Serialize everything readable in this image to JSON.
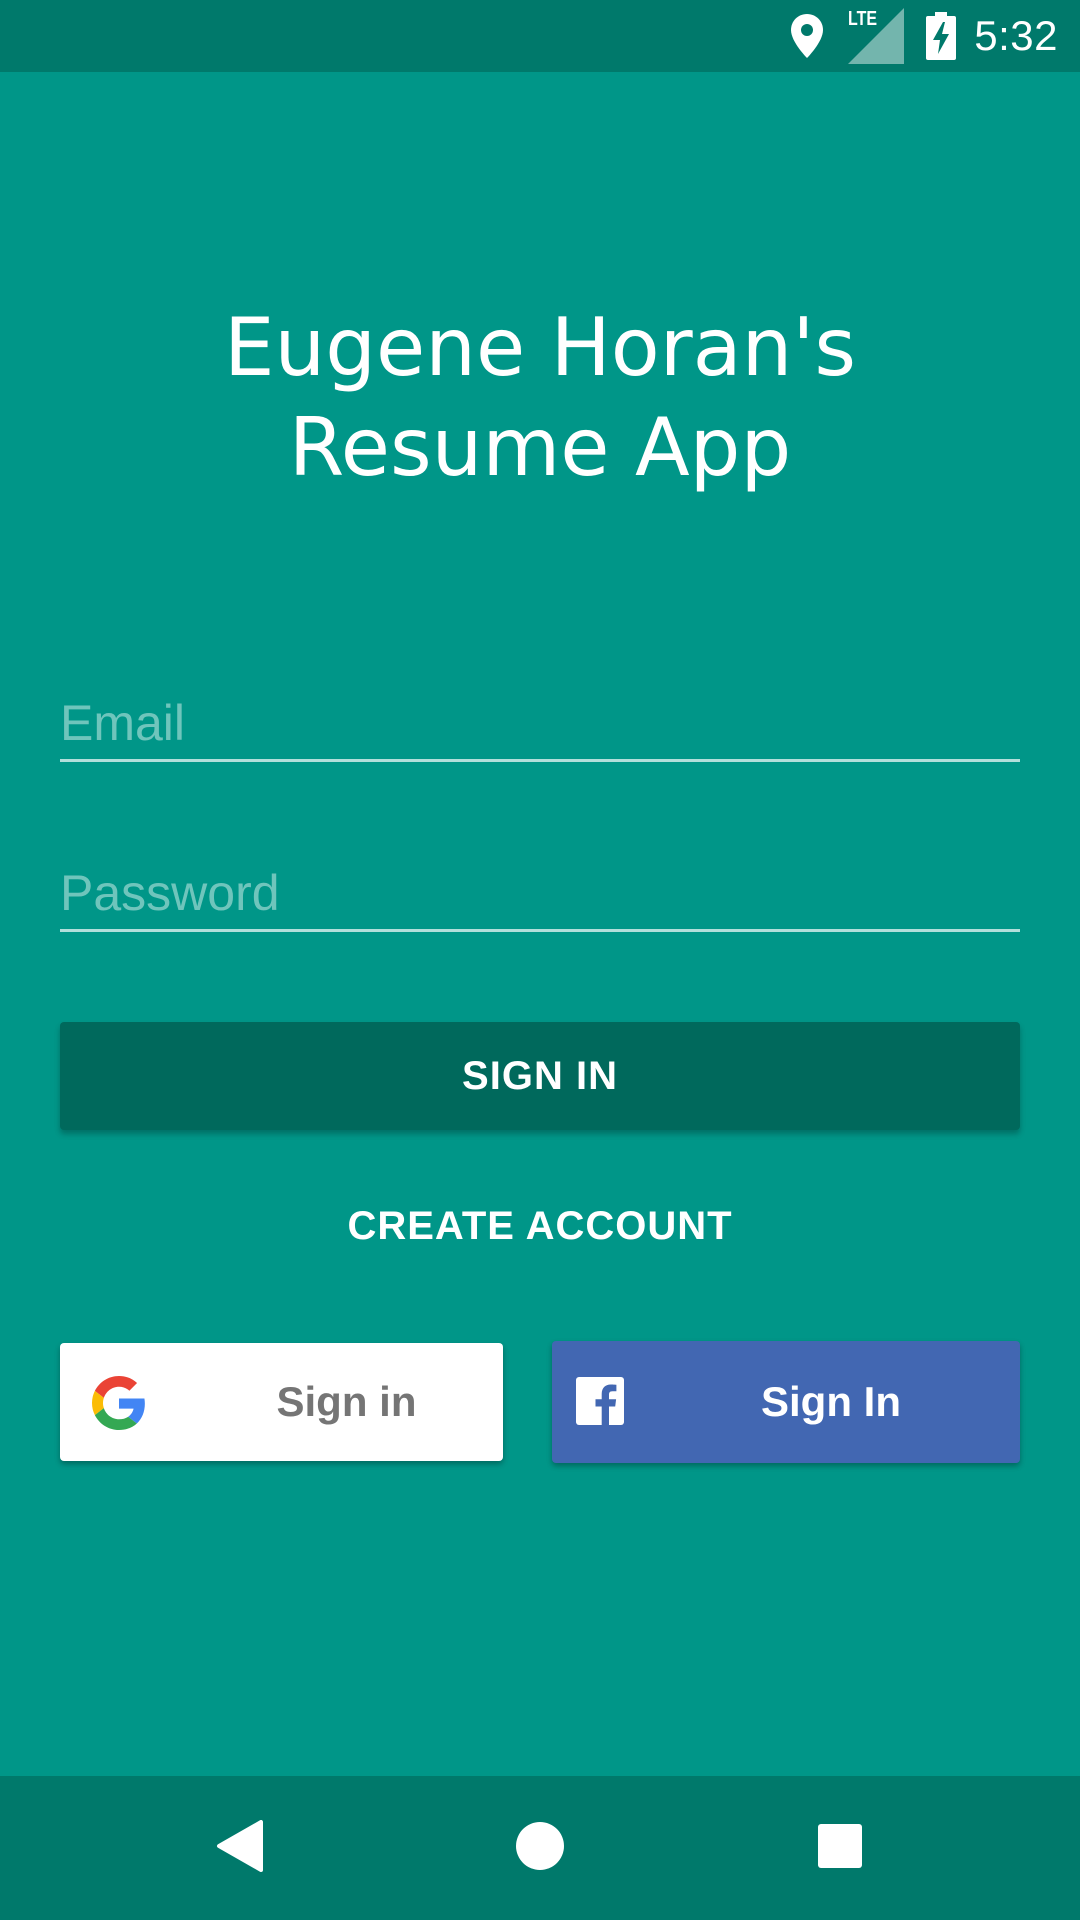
{
  "status_bar": {
    "time": "5:32",
    "network_label": "LTE",
    "icons": [
      "location-icon",
      "signal-icon",
      "battery-charging-icon"
    ]
  },
  "app": {
    "title_line1": "Eugene Horan's",
    "title_line2": "Resume App"
  },
  "form": {
    "email": {
      "value": "",
      "placeholder": "Email"
    },
    "password": {
      "value": "",
      "placeholder": "Password"
    }
  },
  "actions": {
    "sign_in_label": "SIGN IN",
    "create_account_label": "CREATE ACCOUNT",
    "google_label": "Sign in",
    "facebook_label": "Sign In"
  },
  "nav": {
    "icons": [
      "back-icon",
      "home-icon",
      "recents-icon"
    ]
  },
  "colors": {
    "background": "#009688",
    "status_bar": "#00796B",
    "primary_button": "#00695C",
    "facebook_blue": "#4267B2",
    "google_button": "#FFFFFF"
  }
}
